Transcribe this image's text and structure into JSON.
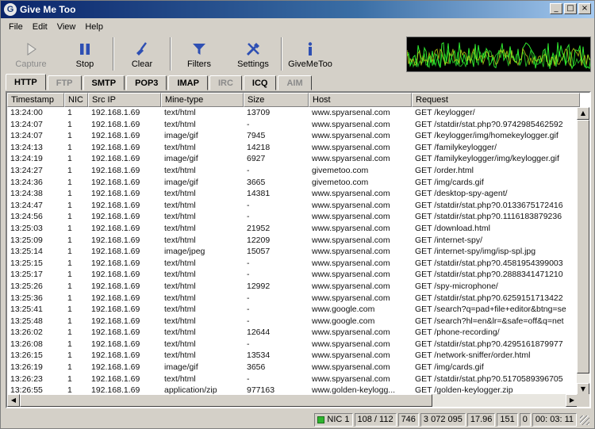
{
  "window": {
    "title": "Give Me Too",
    "icon_letter": "G"
  },
  "menu": [
    "File",
    "Edit",
    "View",
    "Help"
  ],
  "toolbar": [
    {
      "name": "capture",
      "label": "Capture",
      "icon": "play-icon",
      "disabled": true
    },
    {
      "name": "stop",
      "label": "Stop",
      "icon": "pause-icon",
      "disabled": false
    },
    {
      "name": "clear",
      "label": "Clear",
      "icon": "broom-icon",
      "disabled": false
    },
    {
      "name": "filters",
      "label": "Filters",
      "icon": "funnel-icon",
      "disabled": false
    },
    {
      "name": "settings",
      "label": "Settings",
      "icon": "tools-icon",
      "disabled": false
    },
    {
      "name": "givemetoo",
      "label": "GiveMeToo",
      "icon": "info-icon",
      "disabled": false
    }
  ],
  "tabs": [
    {
      "label": "HTTP",
      "active": true,
      "disabled": false
    },
    {
      "label": "FTP",
      "active": false,
      "disabled": true
    },
    {
      "label": "SMTP",
      "active": false,
      "disabled": false
    },
    {
      "label": "POP3",
      "active": false,
      "disabled": false
    },
    {
      "label": "IMAP",
      "active": false,
      "disabled": false
    },
    {
      "label": "IRC",
      "active": false,
      "disabled": true
    },
    {
      "label": "ICQ",
      "active": false,
      "disabled": false
    },
    {
      "label": "AIM",
      "active": false,
      "disabled": true
    }
  ],
  "table": {
    "columns": [
      "Timestamp",
      "NIC",
      "Src IP",
      "Mine-type",
      "Size",
      "Host",
      "Request"
    ],
    "rows": [
      [
        "13:24:00",
        "1",
        "192.168.1.69",
        "text/html",
        "13709",
        "www.spyarsenal.com",
        "GET /keylogger/"
      ],
      [
        "13:24:07",
        "1",
        "192.168.1.69",
        "text/html",
        "-",
        "www.spyarsenal.com",
        "GET /statdir/stat.php?0.9742985462592"
      ],
      [
        "13:24:07",
        "1",
        "192.168.1.69",
        "image/gif",
        "7945",
        "www.spyarsenal.com",
        "GET /keylogger/img/homekeylogger.gif"
      ],
      [
        "13:24:13",
        "1",
        "192.168.1.69",
        "text/html",
        "14218",
        "www.spyarsenal.com",
        "GET /familykeylogger/"
      ],
      [
        "13:24:19",
        "1",
        "192.168.1.69",
        "image/gif",
        "6927",
        "www.spyarsenal.com",
        "GET /familykeylogger/img/keylogger.gif"
      ],
      [
        "13:24:27",
        "1",
        "192.168.1.69",
        "text/html",
        "-",
        "givemetoo.com",
        "GET /order.html"
      ],
      [
        "13:24:36",
        "1",
        "192.168.1.69",
        "image/gif",
        "3665",
        "givemetoo.com",
        "GET /img/cards.gif"
      ],
      [
        "13:24:38",
        "1",
        "192.168.1.69",
        "text/html",
        "14381",
        "www.spyarsenal.com",
        "GET /desktop-spy-agent/"
      ],
      [
        "13:24:47",
        "1",
        "192.168.1.69",
        "text/html",
        "-",
        "www.spyarsenal.com",
        "GET /statdir/stat.php?0.0133675172416"
      ],
      [
        "13:24:56",
        "1",
        "192.168.1.69",
        "text/html",
        "-",
        "www.spyarsenal.com",
        "GET /statdir/stat.php?0.1116183879236"
      ],
      [
        "13:25:03",
        "1",
        "192.168.1.69",
        "text/html",
        "21952",
        "www.spyarsenal.com",
        "GET /download.html"
      ],
      [
        "13:25:09",
        "1",
        "192.168.1.69",
        "text/html",
        "12209",
        "www.spyarsenal.com",
        "GET /internet-spy/"
      ],
      [
        "13:25:14",
        "1",
        "192.168.1.69",
        "image/jpeg",
        "15057",
        "www.spyarsenal.com",
        "GET /internet-spy/img/isp-spl.jpg"
      ],
      [
        "13:25:15",
        "1",
        "192.168.1.69",
        "text/html",
        "-",
        "www.spyarsenal.com",
        "GET /statdir/stat.php?0.4581954399003"
      ],
      [
        "13:25:17",
        "1",
        "192.168.1.69",
        "text/html",
        "-",
        "www.spyarsenal.com",
        "GET /statdir/stat.php?0.2888341471210"
      ],
      [
        "13:25:26",
        "1",
        "192.168.1.69",
        "text/html",
        "12992",
        "www.spyarsenal.com",
        "GET /spy-microphone/"
      ],
      [
        "13:25:36",
        "1",
        "192.168.1.69",
        "text/html",
        "-",
        "www.spyarsenal.com",
        "GET /statdir/stat.php?0.6259151713422"
      ],
      [
        "13:25:41",
        "1",
        "192.168.1.69",
        "text/html",
        "-",
        "www.google.com",
        "GET /search?q=pad+file+editor&btng=se"
      ],
      [
        "13:25:48",
        "1",
        "192.168.1.69",
        "text/html",
        "-",
        "www.google.com",
        "GET /search?hl=en&lr=&safe=off&q=net"
      ],
      [
        "13:26:02",
        "1",
        "192.168.1.69",
        "text/html",
        "12644",
        "www.spyarsenal.com",
        "GET /phone-recording/"
      ],
      [
        "13:26:08",
        "1",
        "192.168.1.69",
        "text/html",
        "-",
        "www.spyarsenal.com",
        "GET /statdir/stat.php?0.4295161879977"
      ],
      [
        "13:26:15",
        "1",
        "192.168.1.69",
        "text/html",
        "13534",
        "www.spyarsenal.com",
        "GET /network-sniffer/order.html"
      ],
      [
        "13:26:19",
        "1",
        "192.168.1.69",
        "image/gif",
        "3656",
        "www.spyarsenal.com",
        "GET /img/cards.gif"
      ],
      [
        "13:26:23",
        "1",
        "192.168.1.69",
        "text/html",
        "-",
        "www.spyarsenal.com",
        "GET /statdir/stat.php?0.5170589396705"
      ],
      [
        "13:26:55",
        "1",
        "192.168.1.69",
        "application/zip",
        "977163",
        "www.golden-keylogg...",
        "GET /golden-keylogger.zip"
      ]
    ]
  },
  "status": {
    "nic": "NIC 1",
    "packets": "108 / 112",
    "count": "746",
    "bytes": "3 072 095",
    "rate": "17.96",
    "value2": "151",
    "value3": "0",
    "elapsed": "00: 03: 11"
  },
  "colors": {
    "title_start": "#0a246a",
    "monitor_bg": "#000000",
    "monitor_trace": "#2ee82e",
    "led": "#2fb52f"
  }
}
